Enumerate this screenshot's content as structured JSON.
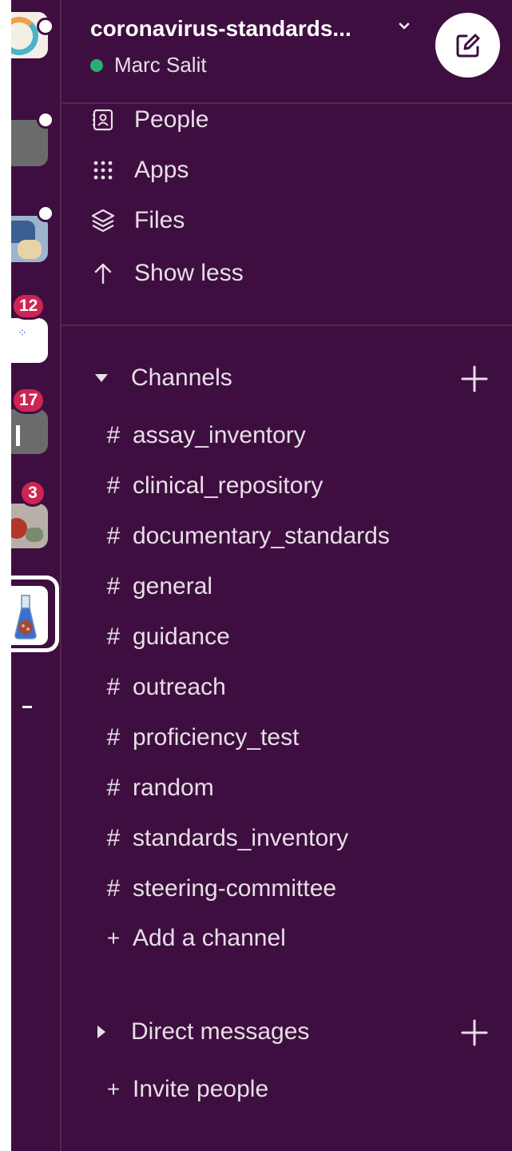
{
  "workspace": {
    "name": "coronavirus-standards...",
    "user": "Marc Salit",
    "status_color": "#2bac76"
  },
  "rail": {
    "badges": [
      "12",
      "17",
      "3"
    ]
  },
  "nav": [
    {
      "label": "People",
      "icon": "people-icon"
    },
    {
      "label": "Apps",
      "icon": "apps-grid-icon"
    },
    {
      "label": "Files",
      "icon": "files-stack-icon"
    },
    {
      "label": "Show less",
      "icon": "arrow-up-icon"
    }
  ],
  "channels_section": {
    "title": "Channels",
    "items": [
      "assay_inventory",
      "clinical_repository",
      "documentary_standards",
      "general",
      "guidance",
      "outreach",
      "proficiency_test",
      "random",
      "standards_inventory",
      "steering-committee"
    ],
    "hash": "#",
    "add_label": "Add a channel"
  },
  "dm_section": {
    "title": "Direct messages",
    "invite_label": "Invite people"
  },
  "plus_glyph": "+",
  "colors": {
    "sidebar_bg": "#3f0e40",
    "badge": "#cd2553",
    "text": "#e6dfe7"
  }
}
